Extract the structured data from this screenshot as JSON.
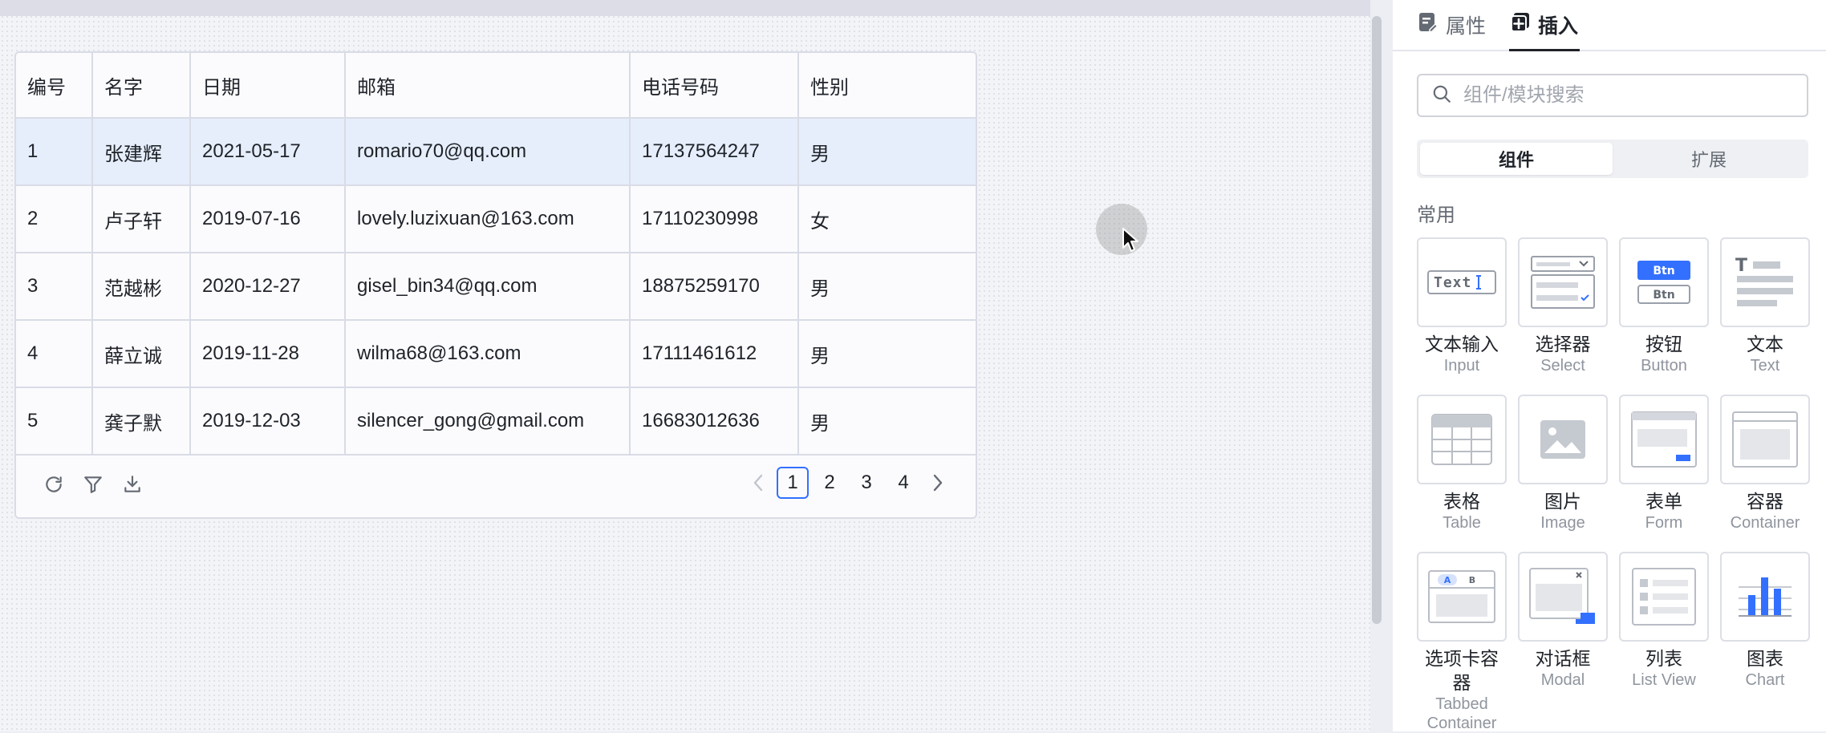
{
  "table": {
    "columns": [
      "编号",
      "名字",
      "日期",
      "邮箱",
      "电话号码",
      "性别"
    ],
    "rows": [
      [
        "1",
        "张建辉",
        "2021-05-17",
        "romario70@qq.com",
        "17137564247",
        "男"
      ],
      [
        "2",
        "卢子轩",
        "2019-07-16",
        "lovely.luzixuan@163.com",
        "17110230998",
        "女"
      ],
      [
        "3",
        "范越彬",
        "2020-12-27",
        "gisel_bin34@qq.com",
        "18875259170",
        "男"
      ],
      [
        "4",
        "薛立诚",
        "2019-11-28",
        "wilma68@163.com",
        "17111461612",
        "男"
      ],
      [
        "5",
        "龚子默",
        "2019-12-03",
        "silencer_gong@gmail.com",
        "16683012636",
        "男"
      ]
    ],
    "selected_row": 1,
    "toolbar_icons": [
      "refresh-icon",
      "filter-icon",
      "download-icon"
    ],
    "pagination": {
      "pages": [
        "1",
        "2",
        "3",
        "4"
      ],
      "current": "1"
    }
  },
  "panel": {
    "tabs": [
      {
        "label": "属性",
        "icon": "properties-icon"
      },
      {
        "label": "插入",
        "icon": "insert-icon",
        "active": true
      }
    ],
    "search": {
      "placeholder": "组件/模块搜索"
    },
    "segments": [
      {
        "label": "组件",
        "active": true
      },
      {
        "label": "扩展"
      }
    ],
    "section_title": "常用",
    "components": [
      {
        "cn": "文本输入",
        "en": "Input",
        "icon": "text-input-icon"
      },
      {
        "cn": "选择器",
        "en": "Select",
        "icon": "select-icon"
      },
      {
        "cn": "按钮",
        "en": "Button",
        "icon": "button-icon"
      },
      {
        "cn": "文本",
        "en": "Text",
        "icon": "text-icon"
      },
      {
        "cn": "表格",
        "en": "Table",
        "icon": "table-icon"
      },
      {
        "cn": "图片",
        "en": "Image",
        "icon": "image-icon"
      },
      {
        "cn": "表单",
        "en": "Form",
        "icon": "form-icon"
      },
      {
        "cn": "容器",
        "en": "Container",
        "icon": "container-icon"
      },
      {
        "cn": "选项卡容器",
        "en": "Tabbed Container",
        "icon": "tabbed-container-icon"
      },
      {
        "cn": "对话框",
        "en": "Modal",
        "icon": "modal-icon"
      },
      {
        "cn": "列表",
        "en": "List View",
        "icon": "list-view-icon"
      },
      {
        "cn": "图表",
        "en": "Chart",
        "icon": "chart-icon"
      }
    ],
    "icon_text": {
      "input": "Text",
      "btn": "Btn",
      "text_t": "T",
      "tab_a": "A",
      "tab_b": "B"
    }
  },
  "colors": {
    "accent": "#3370ff",
    "selected_row_bg": "#e6eefc",
    "border": "#d9dce6"
  }
}
